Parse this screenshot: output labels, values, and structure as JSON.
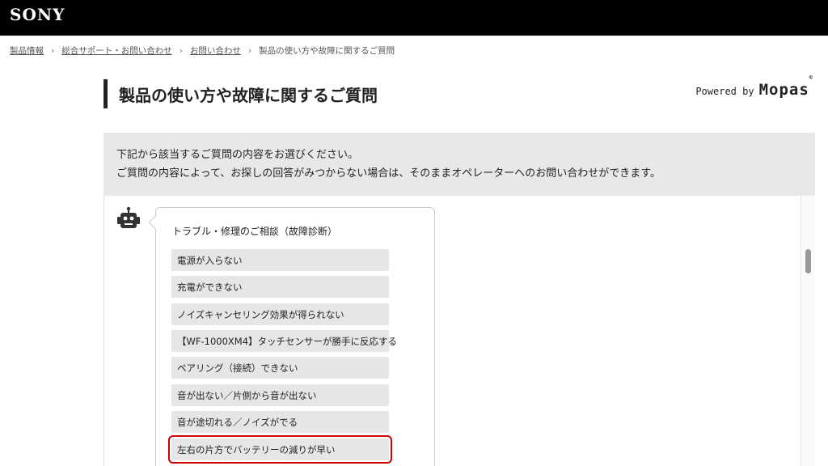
{
  "header": {
    "logo": "SONY"
  },
  "breadcrumb": {
    "items": [
      "製品情報",
      "総合サポート・お問い合わせ",
      "お問い合わせ"
    ],
    "separator": "›",
    "current": "製品の使い方や故障に関するご質問"
  },
  "page": {
    "title": "製品の使い方や故障に関するご質問",
    "powered_prefix": "Powered by",
    "powered_brand": "Mopas",
    "powered_mark": "©"
  },
  "notice": {
    "line1": "下記から該当するご質問の内容をお選びください。",
    "line2": "ご質問の内容によって、お探しの回答がみつからない場合は、そのままオペレーターへのお問い合わせができます。"
  },
  "chat": {
    "heading": "トラブル・修理のご相談（故障診断）",
    "options": [
      "電源が入らない",
      "充電ができない",
      "ノイズキャンセリング効果が得られない",
      "【WF-1000XM4】タッチセンサーが勝手に反応する",
      "ペアリング（接続）できない",
      "音が出ない／片側から音が出ない",
      "音が途切れる／ノイズがでる",
      "左右の片方でバッテリーの減りが早い"
    ],
    "highlighted_option": "左右の片方でバッテリーの減りが早い",
    "highlight_color": "#d00000"
  },
  "icons": {
    "bot": "robot-icon"
  }
}
